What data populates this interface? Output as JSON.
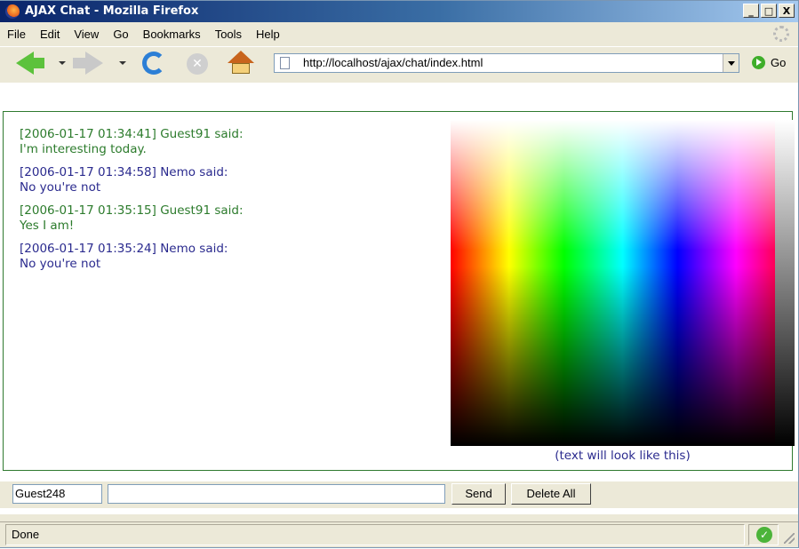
{
  "window": {
    "title": "AJAX Chat - Mozilla Firefox",
    "buttons": [
      "_",
      "□",
      "X"
    ]
  },
  "menu": [
    "File",
    "Edit",
    "View",
    "Go",
    "Bookmarks",
    "Tools",
    "Help"
  ],
  "toolbar": {
    "url": "http://localhost/ajax/chat/index.html",
    "go_label": "Go"
  },
  "chat": {
    "messages": [
      {
        "header": "[2006-01-17 01:34:41] Guest91 said:",
        "text": "I'm interesting today.",
        "color": "#2c7b2c"
      },
      {
        "header": "[2006-01-17 01:34:58] Nemo said:",
        "text": "No you're not",
        "color": "#2a2a8e"
      },
      {
        "header": "[2006-01-17 01:35:15] Guest91 said:",
        "text": "Yes I am!",
        "color": "#2c7b2c"
      },
      {
        "header": "[2006-01-17 01:35:24] Nemo said:",
        "text": "No you're not",
        "color": "#2a2a8e"
      }
    ],
    "preview_text": "(text will look like this)",
    "preview_color": "#2a2a8e"
  },
  "input": {
    "username": "Guest248",
    "message": "",
    "send_label": "Send",
    "delete_label": "Delete All"
  },
  "status": {
    "text": "Done"
  },
  "icons": {
    "window": "firefox-icon",
    "back": "back-arrow-icon",
    "forward": "forward-arrow-icon",
    "reload": "reload-icon",
    "stop": "stop-icon",
    "home": "home-icon",
    "go": "go-icon",
    "status_ok": "checkmark-icon"
  }
}
